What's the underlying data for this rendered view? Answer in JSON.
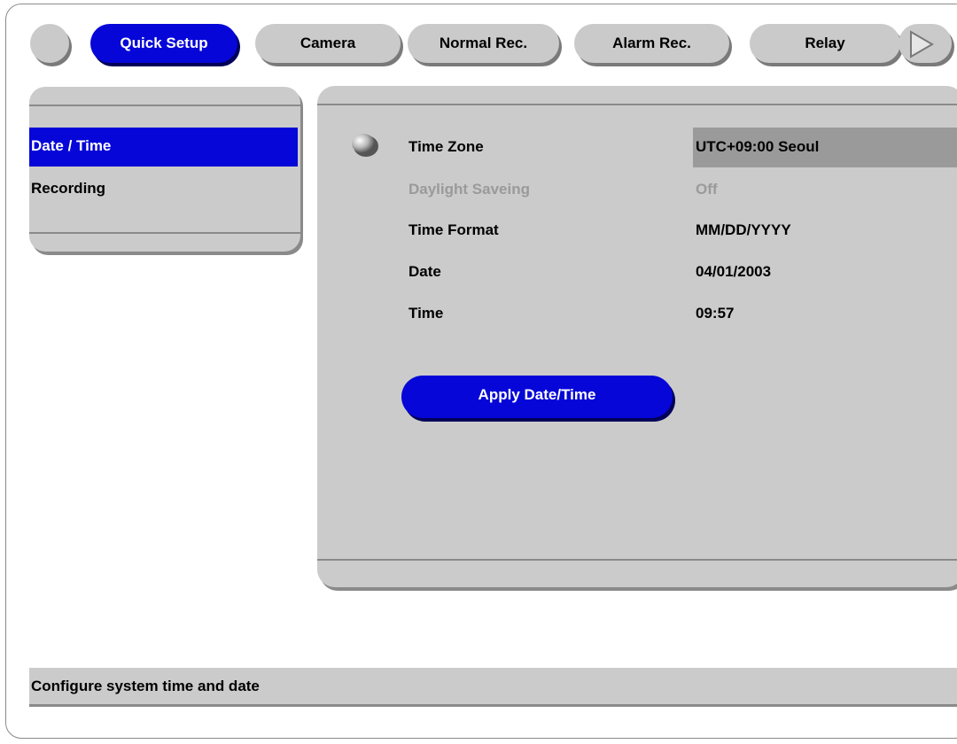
{
  "tabs": [
    {
      "label": "Quick Setup",
      "active": true
    },
    {
      "label": "Camera",
      "active": false
    },
    {
      "label": "Normal Rec.",
      "active": false
    },
    {
      "label": "Alarm Rec.",
      "active": false
    },
    {
      "label": "Relay",
      "active": false
    }
  ],
  "menu": {
    "items": [
      {
        "label": "Date / Time",
        "selected": true
      },
      {
        "label": "Recording",
        "selected": false
      }
    ]
  },
  "settings": [
    {
      "label": "Time Zone",
      "value": "UTC+09:00 Seoul",
      "enabled": true,
      "focused": true
    },
    {
      "label": "Daylight Saveing",
      "value": "Off",
      "enabled": false,
      "focused": false
    },
    {
      "label": "Time Format",
      "value": "MM/DD/YYYY",
      "enabled": true,
      "focused": false
    },
    {
      "label": "Date",
      "value": "04/01/2003",
      "enabled": true,
      "focused": false
    },
    {
      "label": "Time",
      "value": "09:57",
      "enabled": true,
      "focused": false
    }
  ],
  "apply_button": {
    "label": "Apply Date/Time"
  },
  "status_text": "Configure system time and date",
  "colors": {
    "accent": "#0606d8",
    "panel": "#cbcbcb",
    "highlight": "#9a9a9a",
    "disabled_text": "#9a9a9a"
  },
  "icons": {
    "tab_start": "circle-button-icon",
    "tab_next": "play-arrow-icon",
    "row_bullet": "sphere-bullet-icon"
  }
}
